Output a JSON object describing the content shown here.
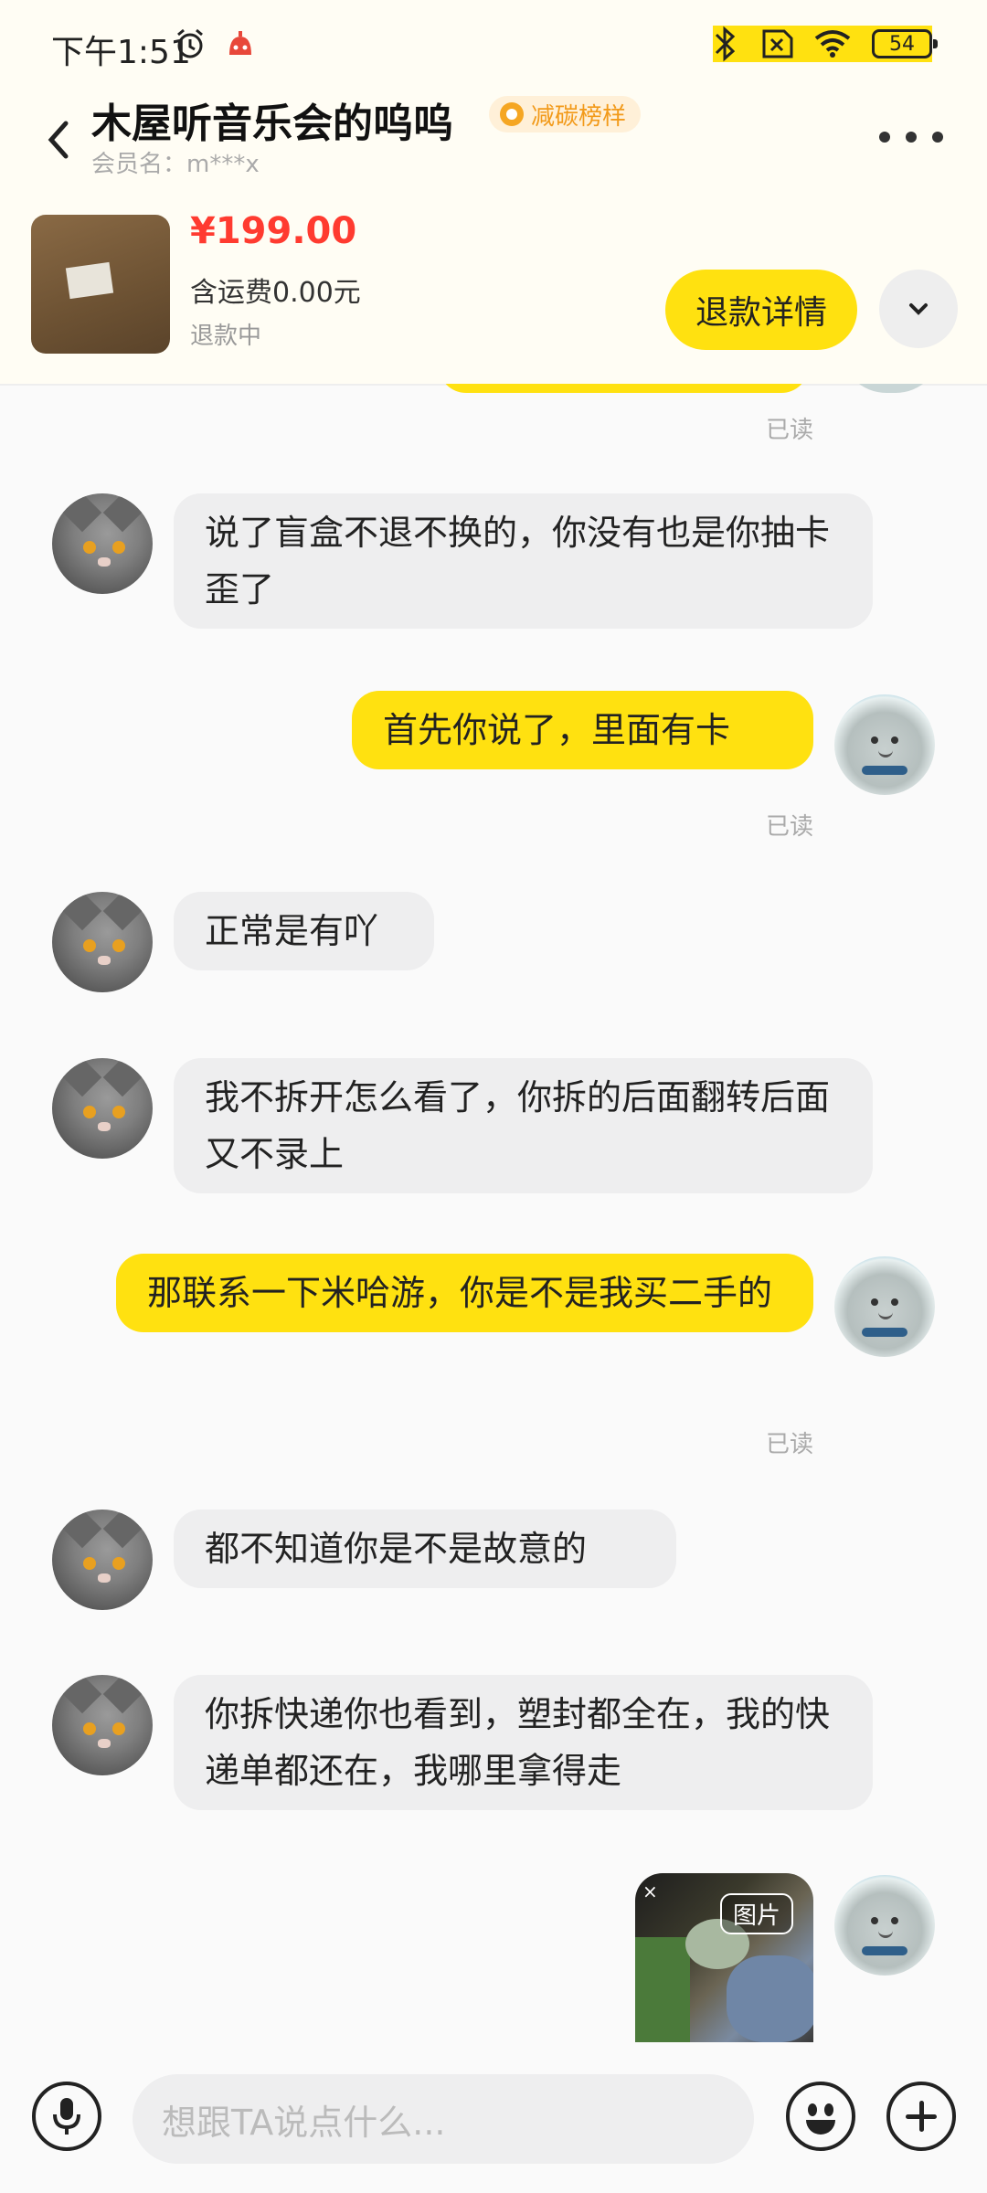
{
  "status_bar": {
    "time": "下午1:51",
    "battery": "54"
  },
  "header": {
    "title": "木屋听音乐会的呜呜",
    "badge": "减碳榜样",
    "member": "会员名：m***x"
  },
  "product": {
    "price": "¥199.00",
    "shipping": "含运费0.00元",
    "status": "退款中",
    "refund_button": "退款详情"
  },
  "messages": [
    {
      "side": "left",
      "text": "说了盲盒不退不换的，你没有也是你抽卡歪了"
    },
    {
      "side": "right",
      "text": "首先你说了，里面有卡",
      "read": "已读"
    },
    {
      "side": "left",
      "text": "正常是有吖"
    },
    {
      "side": "left",
      "text": "我不拆开怎么看了，你拆的后面翻转后面又不录上"
    },
    {
      "side": "right",
      "text": "那联系一下米哈游，你是不是我买二手的",
      "read": "已读"
    },
    {
      "side": "left",
      "text": "都不知道你是不是故意的"
    },
    {
      "side": "left",
      "text": "你拆快递你也看到，塑封都全在，我的快递单都还在，我哪里拿得走"
    }
  ],
  "read_label": "已读",
  "image_message": {
    "tag": "图片",
    "close": "×"
  },
  "input": {
    "placeholder": "想跟TA说点什么..."
  },
  "icons": [
    "alarm-icon",
    "bluetooth-icon",
    "wifi-icon",
    "battery-icon",
    "back-icon",
    "more-icon",
    "chevron-down-icon",
    "mic-icon",
    "emoji-icon",
    "plus-icon"
  ],
  "colors": {
    "accent": "#ffe110",
    "price": "#ff3b30",
    "badge": "#f29a1a"
  }
}
